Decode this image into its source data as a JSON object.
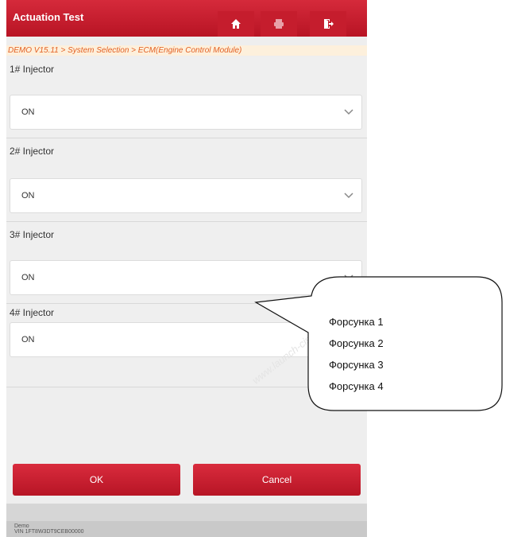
{
  "header": {
    "title": "Actuation Test",
    "icons": [
      "home-icon",
      "print-icon",
      "exit-icon"
    ]
  },
  "breadcrumb": "DEMO V15.11 > System Selection > ECM(Engine Control Module)",
  "injectors": [
    {
      "label": "1# Injector",
      "value": "ON"
    },
    {
      "label": "2# Injector",
      "value": "ON"
    },
    {
      "label": "3# Injector",
      "value": "ON"
    },
    {
      "label": "4# Injector",
      "value": "ON"
    }
  ],
  "buttons": {
    "ok": "OK",
    "cancel": "Cancel"
  },
  "status": {
    "line1": "Demo",
    "line2": "VIN 1FT8W3DT9CEB00000"
  },
  "watermark": "www.launch-cis.ru",
  "callout": [
    "Форсунка 1",
    "Форсунка 2",
    "Форсунка 3",
    "Форсунка 4"
  ],
  "colors": {
    "accent": "#c51d2d",
    "breadcrumb": "#e35f22",
    "breadcrumb_bg": "#fdf0dc"
  }
}
